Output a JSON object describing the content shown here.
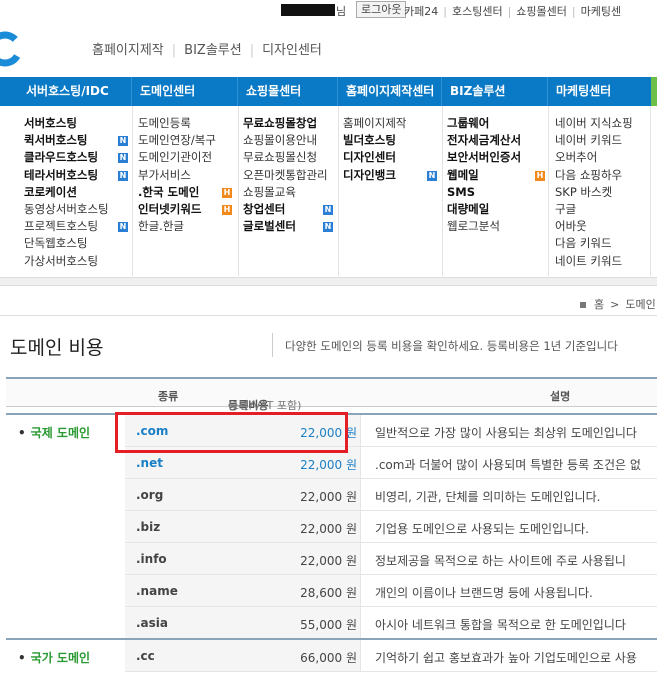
{
  "util": {
    "user_suffix": "님",
    "logout": "로그아웃",
    "links": [
      "카페24",
      "호스팅센터",
      "쇼핑몰센터",
      "마케팅센"
    ]
  },
  "topnav": [
    "홈페이지제작",
    "BIZ솔루션",
    "디자인센터"
  ],
  "menubar": [
    "서버호스팅/IDC",
    "도메인센터",
    "쇼핑몰센터",
    "홈페이지제작센터",
    "BIZ솔루션",
    "마케팅센터"
  ],
  "dropdown": {
    "col1": [
      {
        "t": "서버호스팅",
        "b": true
      },
      {
        "t": "퀵서버호스팅",
        "b": true,
        "badge": "N"
      },
      {
        "t": "클라우드호스팅",
        "b": true,
        "badge": "N"
      },
      {
        "t": "테라서버호스팅",
        "b": true,
        "badge": "N"
      },
      {
        "t": "코로케이션",
        "b": true
      },
      {
        "t": "동영상서버호스팅"
      },
      {
        "t": "프로젝트호스팅",
        "badge": "N"
      },
      {
        "t": "단독웹호스팅"
      },
      {
        "t": "가상서버호스팅"
      }
    ],
    "col2": [
      {
        "t": "도메인등록"
      },
      {
        "t": "도메인연장/복구"
      },
      {
        "t": "도메인기관이전"
      },
      {
        "t": "부가서비스"
      },
      {
        "t": ".한국 도메인",
        "b": true,
        "badge": "H"
      },
      {
        "t": "인터넷키워드",
        "b": true,
        "badge": "H"
      },
      {
        "t": "한글.한글"
      }
    ],
    "col3": [
      {
        "t": "무료쇼핑몰창업",
        "b": true
      },
      {
        "t": "쇼핑몰이용안내"
      },
      {
        "t": "무료쇼핑몰신청"
      },
      {
        "t": "오픈마켓통합관리"
      },
      {
        "t": "쇼핑몰교육"
      },
      {
        "t": "창업센터",
        "b": true,
        "badge": "N"
      },
      {
        "t": "글로벌센터",
        "b": true,
        "badge": "N"
      }
    ],
    "col4": [
      {
        "t": "홈페이지제작"
      },
      {
        "t": "빌더호스팅",
        "b": true
      },
      {
        "t": "디자인센터",
        "b": true
      },
      {
        "t": "디자인뱅크",
        "b": true,
        "badge": "N"
      }
    ],
    "col5": [
      {
        "t": "그룹웨어",
        "b": true
      },
      {
        "t": "전자세금계산서",
        "b": true
      },
      {
        "t": "보안서버인증서",
        "b": true
      },
      {
        "t": "웹메일",
        "b": true,
        "badge": "H"
      },
      {
        "t": "SMS",
        "b": true
      },
      {
        "t": "대량메일",
        "b": true
      },
      {
        "t": "웹로그분석"
      }
    ],
    "col6": [
      {
        "t": "네이버 지식쇼핑"
      },
      {
        "t": "네이버 키워드"
      },
      {
        "t": "오버추어"
      },
      {
        "t": "다음 쇼핑하우"
      },
      {
        "t": "SKP 바스켓"
      },
      {
        "t": "구글"
      },
      {
        "t": "어바웃"
      },
      {
        "t": "다음 키워드"
      },
      {
        "t": "네이트 키워드"
      }
    ]
  },
  "breadcrumb": {
    "home": "홈",
    "current": "도메인"
  },
  "page": {
    "title": "도메인 비용",
    "desc": "다양한 도메인의 등록 비용을 확인하세요. 등록비용은 1년 기준입니다"
  },
  "table": {
    "headers": {
      "type": "종류",
      "price": "등록비용",
      "price_sub": "(1년/VAT 포함)",
      "desc": "설명"
    },
    "categories": [
      "국제 도메인",
      "국가 도메인"
    ],
    "rows": [
      {
        "name": ".com",
        "price": "22,000 원",
        "desc": "일반적으로 가장 많이 사용되는 최상위 도메인입니다"
      },
      {
        "name": ".net",
        "price": "22,000 원",
        "desc": ".com과 더불어 많이 사용되며 특별한 등록 조건은 없"
      },
      {
        "name": ".org",
        "price": "22,000 원",
        "desc": "비영리, 기관, 단체를 의미하는 도메인입니다."
      },
      {
        "name": ".biz",
        "price": "22,000 원",
        "desc": "기업용 도메인으로 사용되는 도메인입니다."
      },
      {
        "name": ".info",
        "price": "22,000 원",
        "desc": "정보제공을 목적으로 하는 사이트에 주로 사용됩니"
      },
      {
        "name": ".name",
        "price": "28,600 원",
        "desc": "개인의 이름이나 브랜드명 등에 사용됩니다."
      },
      {
        "name": ".asia",
        "price": "55,000 원",
        "desc": "아시아 네트워크 통합을 목적으로 한 도메인입니다"
      },
      {
        "name": ".cc",
        "price": "66,000 원",
        "desc": "기억하기 쉽고 홍보효과가 높아 기업도메인으로 사용"
      }
    ]
  },
  "colors": {
    "menu_blue": "#0a79c6",
    "link_blue": "#1a7fc6",
    "category_green": "#2a9a32",
    "highlight_red": "#e31e24"
  }
}
